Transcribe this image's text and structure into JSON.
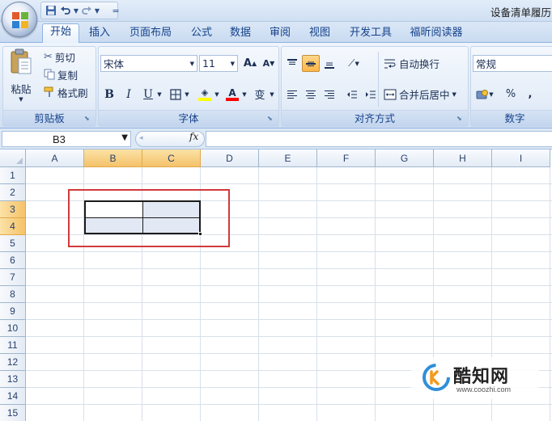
{
  "title": {
    "text": "设备清单履历"
  },
  "quick_access": {
    "save": "save-icon",
    "undo": "undo-icon",
    "redo": "redo-icon",
    "customize": "="
  },
  "tabs": [
    {
      "label": "开始",
      "active": true
    },
    {
      "label": "插入"
    },
    {
      "label": "页面布局"
    },
    {
      "label": "公式"
    },
    {
      "label": "数据"
    },
    {
      "label": "审阅"
    },
    {
      "label": "视图"
    },
    {
      "label": "开发工具"
    },
    {
      "label": "福昕阅读器"
    }
  ],
  "clipboard": {
    "label": "剪贴板",
    "paste": "粘贴",
    "cut": "剪切",
    "copy": "复制",
    "format_painter": "格式刷"
  },
  "font": {
    "label": "字体",
    "name": "宋体",
    "size": "11",
    "grow": "A",
    "shrink": "A",
    "bold": "B",
    "italic": "I",
    "underline": "U",
    "font_color": "A",
    "phonetic": "变",
    "fill_color_hex": "#ffff00",
    "font_color_hex": "#ff0000"
  },
  "alignment": {
    "label": "对齐方式",
    "wrap_text": "自动换行",
    "merge_center": "合并后居中"
  },
  "number": {
    "label": "数字",
    "format": "常规",
    "percent": "%",
    "comma": ","
  },
  "formula_bar": {
    "name_box": "B3",
    "fx": "fx",
    "value": ""
  },
  "grid": {
    "columns": [
      "A",
      "B",
      "C",
      "D",
      "E",
      "F",
      "G",
      "H",
      "I"
    ],
    "selected_columns": [
      "B",
      "C"
    ],
    "rows": [
      "1",
      "2",
      "3",
      "4",
      "5",
      "6",
      "7",
      "8",
      "9",
      "10",
      "11",
      "12",
      "13",
      "14",
      "15"
    ],
    "selected_rows": [
      "3",
      "4"
    ],
    "highlight_color": "#d23a3a"
  },
  "watermark": {
    "title": "酷知网",
    "url": "www.coozhi.com"
  }
}
